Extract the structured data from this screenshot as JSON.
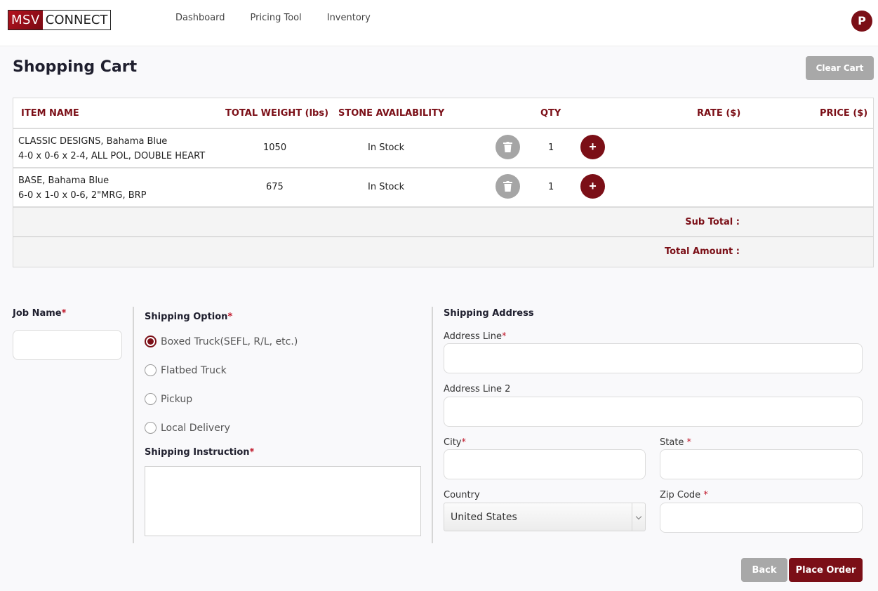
{
  "header": {
    "logo_left": "MSV",
    "logo_right": "CONNECT",
    "nav": [
      "Dashboard",
      "Pricing Tool",
      "Inventory"
    ],
    "avatar": "P"
  },
  "page": {
    "title": "Shopping Cart",
    "clear_label": "Clear Cart"
  },
  "table": {
    "headers": {
      "item": "ITEM NAME",
      "weight": "TOTAL WEIGHT (lbs)",
      "availability": "STONE AVAILABILITY",
      "qty": "QTY",
      "rate": "RATE ($)",
      "price": "PRICE ($)"
    },
    "rows": [
      {
        "line1": "CLASSIC DESIGNS, Bahama Blue",
        "line2": "4-0 x 0-6 x 2-4, ALL POL, DOUBLE HEART",
        "weight": "1050",
        "availability": "In Stock",
        "qty": "1",
        "plus": "+"
      },
      {
        "line1": "BASE, Bahama Blue",
        "line2": "6-0 x 1-0 x 0-6, 2\"MRG, BRP",
        "weight": "675",
        "availability": "In Stock",
        "qty": "1",
        "plus": "+"
      }
    ],
    "subtotal_label": "Sub Total :",
    "total_label": "Total Amount :"
  },
  "form": {
    "job_name": "Job Name",
    "shipping_option": "Shipping Option",
    "options": [
      "Boxed Truck(SEFL, R/L, etc.)",
      "Flatbed Truck",
      "Pickup",
      "Local Delivery"
    ],
    "selected_option": 0,
    "shipping_instruction": "Shipping Instruction",
    "shipping_address": "Shipping Address",
    "address_line": "Address Line",
    "address_line2": "Address Line 2",
    "city": "City",
    "state": "State ",
    "country": "Country",
    "country_value": "United States",
    "zip": "Zip Code ",
    "required_mark": "*"
  },
  "actions": {
    "back": "Back",
    "place_order": "Place Order"
  },
  "colors": {
    "brand": "#7b0f17",
    "muted_button": "#a8a8a8"
  }
}
